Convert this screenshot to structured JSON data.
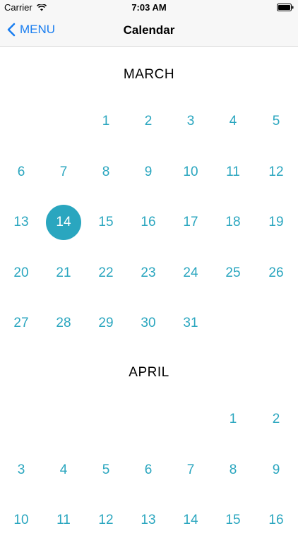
{
  "status_bar": {
    "carrier": "Carrier",
    "time": "7:03 AM"
  },
  "nav": {
    "back_label": "MENU",
    "title": "Calendar"
  },
  "colors": {
    "accent": "#2aa6bf",
    "link": "#1a7ef0"
  },
  "calendar": {
    "selected_day": {
      "month": "MARCH",
      "day": "14"
    },
    "months": [
      {
        "name": "MARCH",
        "weeks": [
          [
            "",
            "",
            "1",
            "2",
            "3",
            "4",
            "5"
          ],
          [
            "6",
            "7",
            "8",
            "9",
            "10",
            "11",
            "12"
          ],
          [
            "13",
            "14",
            "15",
            "16",
            "17",
            "18",
            "19"
          ],
          [
            "20",
            "21",
            "22",
            "23",
            "24",
            "25",
            "26"
          ],
          [
            "27",
            "28",
            "29",
            "30",
            "31",
            "",
            ""
          ]
        ]
      },
      {
        "name": "APRIL",
        "weeks": [
          [
            "",
            "",
            "",
            "",
            "",
            "1",
            "2"
          ],
          [
            "3",
            "4",
            "5",
            "6",
            "7",
            "8",
            "9"
          ],
          [
            "10",
            "11",
            "12",
            "13",
            "14",
            "15",
            "16"
          ]
        ]
      }
    ]
  }
}
